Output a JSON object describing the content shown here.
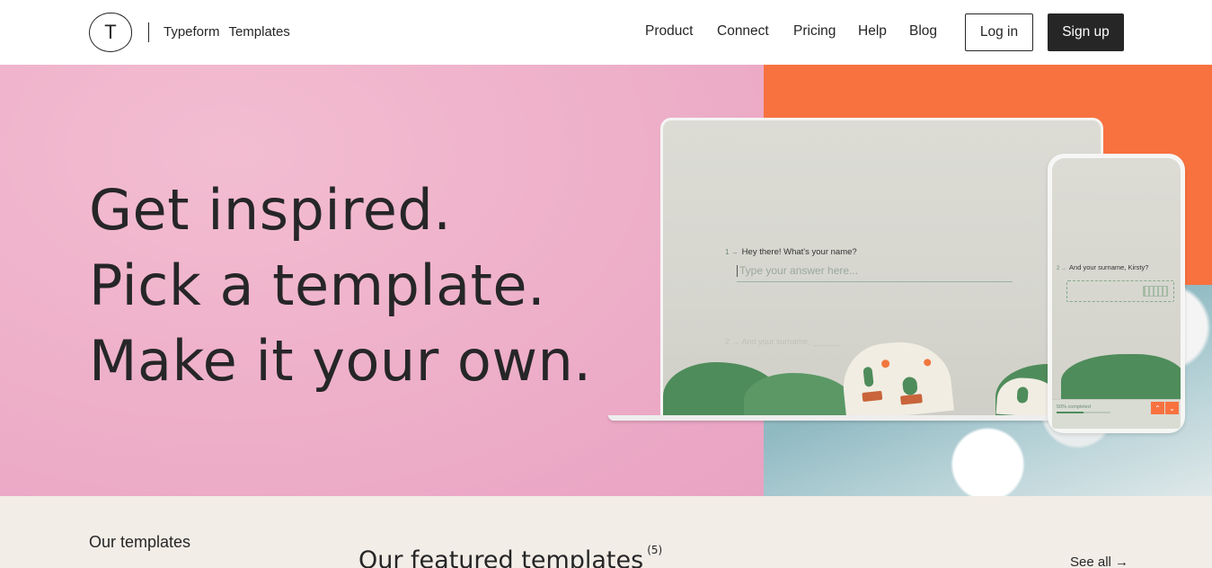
{
  "header": {
    "logo_letter": "T",
    "brand_name": "Typeform",
    "brand_section": "Templates",
    "nav": [
      "Product",
      "Connect",
      "Pricing",
      "Help",
      "Blog"
    ],
    "login_label": "Log in",
    "signup_label": "Sign up"
  },
  "hero": {
    "headline_lines": [
      "Get inspired.",
      "Pick a template.",
      "Make it your own."
    ],
    "colors": {
      "pink": "#eeb0c9",
      "orange": "#f87240",
      "ink": "#262627"
    },
    "laptop": {
      "question_number": "1 →",
      "question": "Hey there! What's your name?",
      "answer_placeholder": "Type your answer here...",
      "next_question_number": "2 →",
      "next_question": "And your surname, ______"
    },
    "phone": {
      "question_number": "2 →",
      "question": "And your surname, Kirsty?",
      "progress_text": "50% completed",
      "progress_value": 0.5,
      "up_arrow": "⌃",
      "down_arrow": "⌄"
    }
  },
  "bottom": {
    "our_templates": "Our templates",
    "featured_title": "Our featured templates",
    "featured_count": "(5)",
    "see_all": "See all →"
  }
}
